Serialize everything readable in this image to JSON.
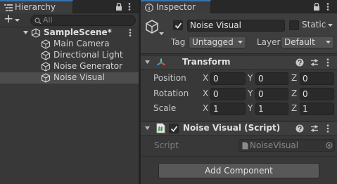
{
  "hierarchy": {
    "tab_label": "Hierarchy",
    "add_label": "+",
    "search_placeholder": "All",
    "scene": {
      "name": "SampleScene*"
    },
    "items": [
      {
        "label": "Main Camera"
      },
      {
        "label": "Directional Light"
      },
      {
        "label": "Noise Generator"
      },
      {
        "label": "Noise Visual",
        "selected": true
      }
    ]
  },
  "inspector": {
    "tab_label": "Inspector",
    "object": {
      "name": "Noise Visual",
      "active": true,
      "static_label": "Static",
      "static": false,
      "tag_label": "Tag",
      "tag_value": "Untagged",
      "layer_label": "Layer",
      "layer_value": "Default"
    },
    "transform": {
      "title": "Transform",
      "rows": [
        {
          "label": "Position",
          "x": "0",
          "y": "0",
          "z": "0"
        },
        {
          "label": "Rotation",
          "x": "0",
          "y": "0",
          "z": "0"
        },
        {
          "label": "Scale",
          "x": "1",
          "y": "1",
          "z": "1"
        }
      ],
      "axis_labels": {
        "x": "X",
        "y": "Y",
        "z": "Z"
      }
    },
    "script_component": {
      "title": "Noise Visual (Script)",
      "enabled": true,
      "script_label": "Script",
      "script_value": "NoiseVisual"
    },
    "add_component_label": "Add Component"
  },
  "colors": {
    "accent": "#3a72b0",
    "panel_bg": "#383838",
    "selection": "#4d4d4d"
  }
}
